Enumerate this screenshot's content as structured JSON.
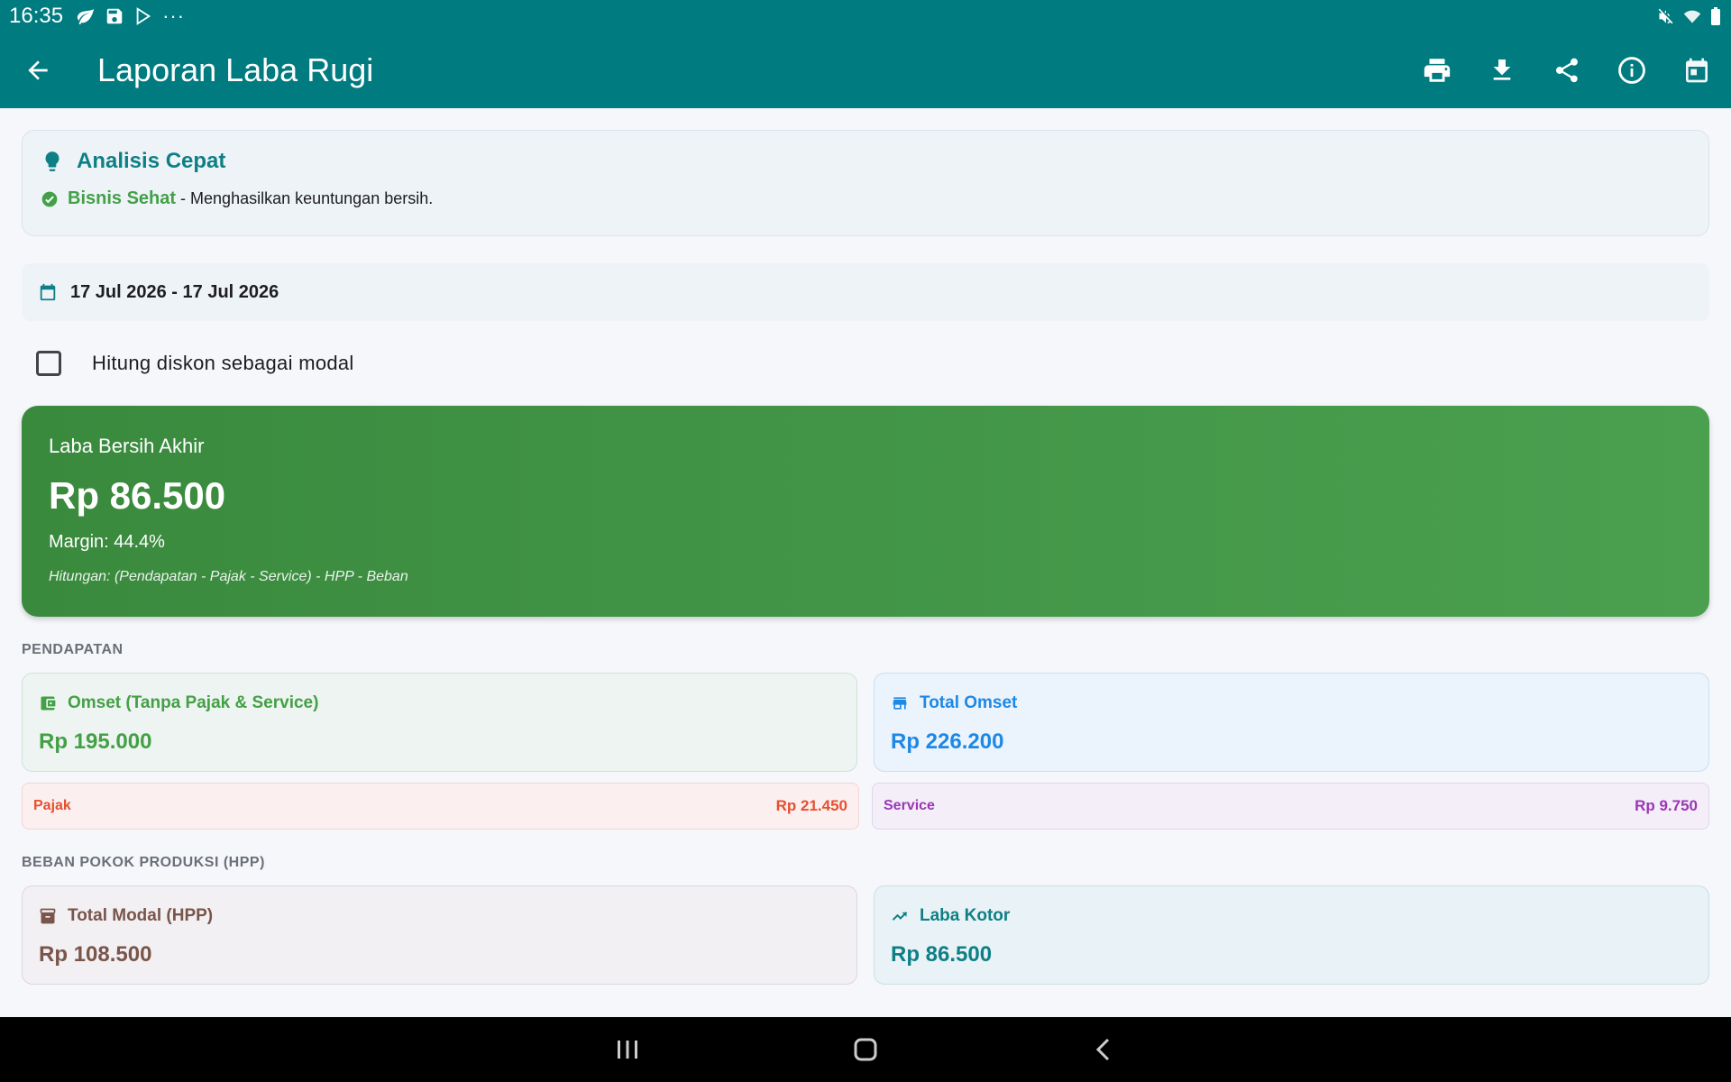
{
  "status": {
    "time": "16:35",
    "more": "···"
  },
  "appbar": {
    "title": "Laporan Laba Rugi"
  },
  "analysis": {
    "title": "Analisis Cepat",
    "status_label": "Bisnis Sehat",
    "status_desc": " - Menghasilkan keuntungan bersih."
  },
  "date_range": "17 Jul 2026 - 17 Jul 2026",
  "discount_option": {
    "label": "Hitung diskon sebagai modal",
    "checked": false
  },
  "net_profit": {
    "label": "Laba Bersih Akhir",
    "amount": "Rp 86.500",
    "margin": "Margin: 44.4%",
    "formula": "Hitungan: (Pendapatan - Pajak - Service) - HPP - Beban"
  },
  "income": {
    "section": "PENDAPATAN",
    "omset_label": "Omset (Tanpa Pajak & Service)",
    "omset_value": "Rp 195.000",
    "total_label": "Total Omset",
    "total_value": "Rp 226.200",
    "tax_label": "Pajak",
    "tax_value": "Rp 21.450",
    "service_label": "Service",
    "service_value": "Rp 9.750"
  },
  "hpp": {
    "section": "BEBAN POKOK PRODUKSI (HPP)",
    "modal_label": "Total Modal (HPP)",
    "modal_value": "Rp 108.500",
    "gross_label": "Laba Kotor",
    "gross_value": "Rp 86.500"
  },
  "colors": {
    "primary": "#007b80",
    "success": "#43a047",
    "info": "#1e88e5",
    "tax": "#e6502f",
    "service": "#9c36b5",
    "hpp": "#79554a"
  }
}
